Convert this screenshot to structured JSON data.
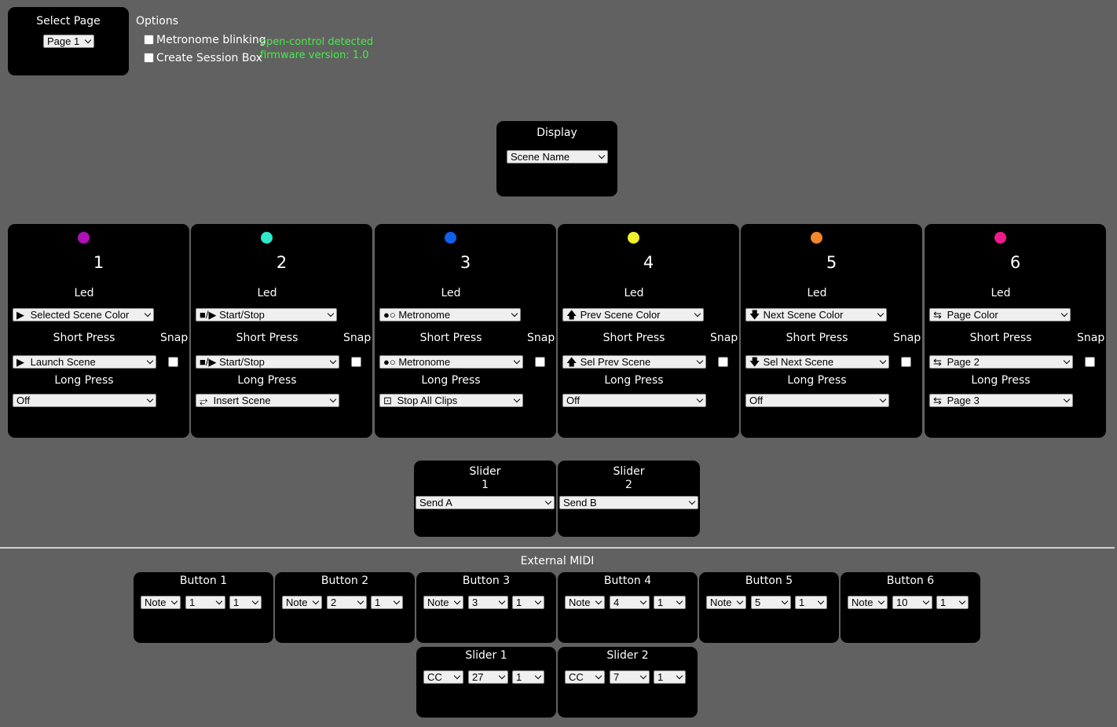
{
  "select_page": {
    "title": "Select Page",
    "value": "Page 1"
  },
  "options": {
    "title": "Options",
    "metronome_label": "Metronome blinking",
    "session_box_label": "Create Session Box",
    "detected": "open-control detected",
    "firmware": "firmware version: 1.0"
  },
  "display": {
    "title": "Display",
    "value": "Scene Name"
  },
  "labels": {
    "led": "Led",
    "short_press": "Short Press",
    "long_press": "Long Press",
    "snap": "Snap"
  },
  "buttons": [
    {
      "number": "1",
      "color": "#b010b8",
      "led": {
        "icon": "▶",
        "text": "Selected Scene Color"
      },
      "short": {
        "icon": "▶",
        "text": "Launch Scene"
      },
      "long": {
        "icon": "",
        "text": "Off"
      }
    },
    {
      "number": "2",
      "color": "#2ee8c8",
      "led": {
        "icon": "■/▶",
        "text": "Start/Stop"
      },
      "short": {
        "icon": "■/▶",
        "text": "Start/Stop"
      },
      "long": {
        "icon": "⥂",
        "text": "Insert Scene"
      }
    },
    {
      "number": "3",
      "color": "#1060f0",
      "led": {
        "icon": "●○",
        "text": "Metronome"
      },
      "short": {
        "icon": "●○",
        "text": "Metronome"
      },
      "long": {
        "icon": "⊡",
        "text": "Stop All Clips"
      }
    },
    {
      "number": "4",
      "color": "#f2f02a",
      "led": {
        "icon": "🡅",
        "text": "Prev Scene Color"
      },
      "short": {
        "icon": "🡅",
        "text": "Sel Prev Scene"
      },
      "long": {
        "icon": "",
        "text": "Off"
      }
    },
    {
      "number": "5",
      "color": "#f5862a",
      "led": {
        "icon": "🡇",
        "text": "Next Scene Color"
      },
      "short": {
        "icon": "🡇",
        "text": "Sel Next Scene"
      },
      "long": {
        "icon": "",
        "text": "Off"
      }
    },
    {
      "number": "6",
      "color": "#f01a8c",
      "led": {
        "icon": "⇆",
        "text": "Page Color"
      },
      "short": {
        "icon": "⇆",
        "text": "Page 2"
      },
      "long": {
        "icon": "⇆",
        "text": "Page 3"
      }
    }
  ],
  "sliders": [
    {
      "title": "Slider",
      "number": "1",
      "value": "Send A"
    },
    {
      "title": "Slider",
      "number": "2",
      "value": "Send B"
    }
  ],
  "external_midi": {
    "title": "External MIDI",
    "buttons": [
      {
        "title": "Button 1",
        "type": "Note",
        "number": "1",
        "channel": "1"
      },
      {
        "title": "Button 2",
        "type": "Note",
        "number": "2",
        "channel": "1"
      },
      {
        "title": "Button 3",
        "type": "Note",
        "number": "3",
        "channel": "1"
      },
      {
        "title": "Button 4",
        "type": "Note",
        "number": "4",
        "channel": "1"
      },
      {
        "title": "Button 5",
        "type": "Note",
        "number": "5",
        "channel": "1"
      },
      {
        "title": "Button 6",
        "type": "Note",
        "number": "10",
        "channel": "1"
      }
    ],
    "sliders": [
      {
        "title": "Slider 1",
        "type": "CC",
        "number": "27",
        "channel": "1"
      },
      {
        "title": "Slider 2",
        "type": "CC",
        "number": "7",
        "channel": "1"
      }
    ]
  }
}
